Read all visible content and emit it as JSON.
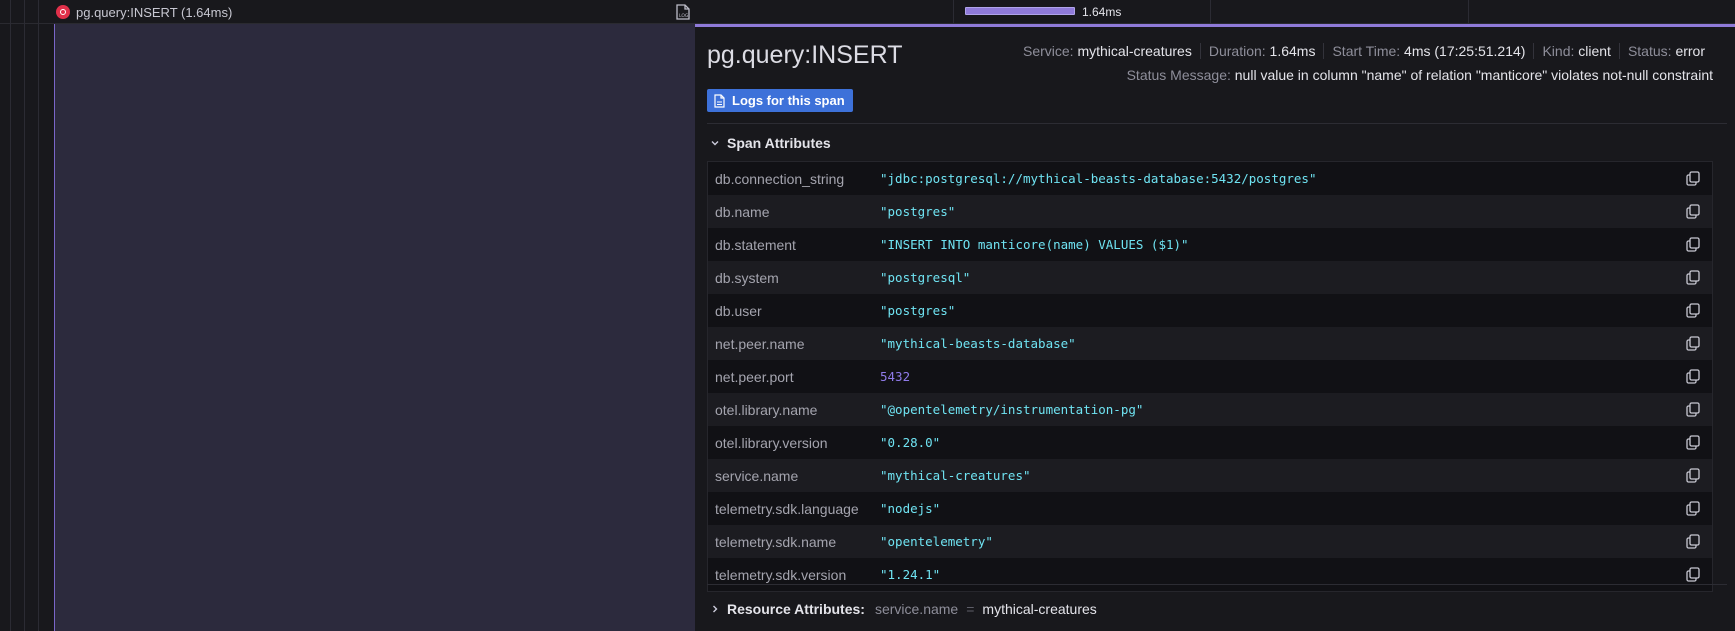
{
  "row": {
    "span_label": "pg.query:INSERT (1.64ms)",
    "bar_label": "1.64ms",
    "logs_icon": "logs-icon"
  },
  "details": {
    "title": "pg.query:INSERT",
    "meta": [
      {
        "key": "Service:",
        "value": "mythical-creatures"
      },
      {
        "key": "Duration:",
        "value": "1.64ms"
      },
      {
        "key": "Start Time:",
        "value": "4ms (17:25:51.214)"
      },
      {
        "key": "Kind:",
        "value": "client"
      },
      {
        "key": "Status:",
        "value": "error"
      }
    ],
    "status_message_key": "Status Message:",
    "status_message": "null value in column \"name\" of relation \"manticore\" violates not-null constraint",
    "logs_button": "Logs for this span",
    "span_attributes_title": "Span Attributes",
    "attributes": [
      {
        "key": "db.connection_string",
        "value": "\"jdbc:postgresql://mythical-beasts-database:5432/postgres\""
      },
      {
        "key": "db.name",
        "value": "\"postgres\""
      },
      {
        "key": "db.statement",
        "value": "\"INSERT INTO manticore(name) VALUES ($1)\""
      },
      {
        "key": "db.system",
        "value": "\"postgresql\""
      },
      {
        "key": "db.user",
        "value": "\"postgres\""
      },
      {
        "key": "net.peer.name",
        "value": "\"mythical-beasts-database\""
      },
      {
        "key": "net.peer.port",
        "value": "5432"
      },
      {
        "key": "otel.library.name",
        "value": "\"@opentelemetry/instrumentation-pg\""
      },
      {
        "key": "otel.library.version",
        "value": "\"0.28.0\""
      },
      {
        "key": "service.name",
        "value": "\"mythical-creatures\""
      },
      {
        "key": "telemetry.sdk.language",
        "value": "\"nodejs\""
      },
      {
        "key": "telemetry.sdk.name",
        "value": "\"opentelemetry\""
      },
      {
        "key": "telemetry.sdk.version",
        "value": "\"1.24.1\""
      }
    ],
    "resource_title": "Resource Attributes:",
    "resource_key": "service.name",
    "resource_eq": "=",
    "resource_value": "mythical-creatures"
  },
  "colors": {
    "accent": "#8f7ad9",
    "string_value": "#6fe3f2",
    "number_value": "#8f7ae8",
    "button": "#3d71d9",
    "error": "#e0304a"
  }
}
